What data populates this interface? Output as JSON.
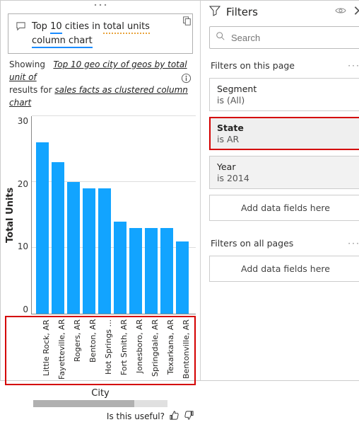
{
  "query": {
    "prefix": "Top",
    "count": "10",
    "mid": "cities in",
    "tail": "total units",
    "line2": "column chart"
  },
  "showing": {
    "label1": "Showing",
    "link1": "Top 10 geo city of geos by total unit of",
    "label2": "results for",
    "link2": "sales facts as clustered column chart"
  },
  "chart_data": {
    "type": "bar",
    "categories": [
      "Little Rock, AR",
      "Fayetteville, AR",
      "Rogers, AR",
      "Benton, AR",
      "Hot Springs ...",
      "Fort Smith, AR",
      "Jonesboro, AR",
      "Springdale, AR",
      "Texarkana, AR",
      "Bentonville, AR"
    ],
    "values": [
      26,
      23,
      20,
      19,
      19,
      14,
      13,
      13,
      13,
      11
    ],
    "xlabel": "City",
    "ylabel": "Total Units",
    "ylim": [
      0,
      30
    ],
    "yticks": [
      0,
      10,
      20,
      30
    ]
  },
  "footer": {
    "useful": "Is this useful?"
  },
  "filters": {
    "title": "Filters",
    "search_placeholder": "Search",
    "page_section": "Filters on this page",
    "all_section": "Filters on all pages",
    "cards": {
      "segment": {
        "name": "Segment",
        "val": "is (All)"
      },
      "state": {
        "name": "State",
        "val": "is AR"
      },
      "year": {
        "name": "Year",
        "val": "is 2014"
      }
    },
    "add": "Add data fields here"
  }
}
